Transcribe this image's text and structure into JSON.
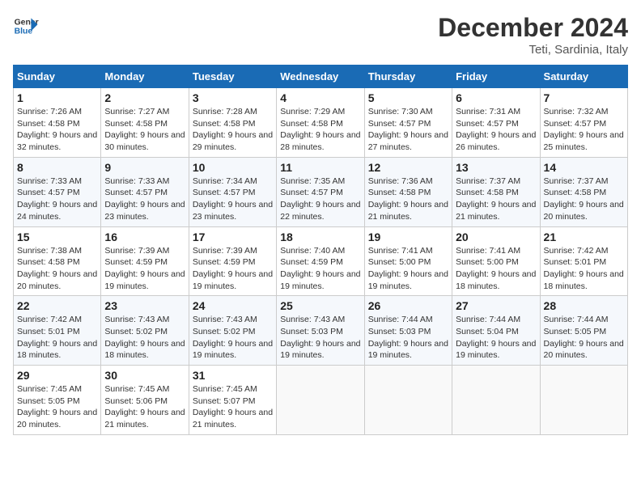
{
  "logo": {
    "line1": "General",
    "line2": "Blue"
  },
  "title": "December 2024",
  "subtitle": "Teti, Sardinia, Italy",
  "days_header": [
    "Sunday",
    "Monday",
    "Tuesday",
    "Wednesday",
    "Thursday",
    "Friday",
    "Saturday"
  ],
  "weeks": [
    [
      {
        "num": "1",
        "sunrise": "7:26 AM",
        "sunset": "4:58 PM",
        "daylight": "9 hours and 32 minutes."
      },
      {
        "num": "2",
        "sunrise": "7:27 AM",
        "sunset": "4:58 PM",
        "daylight": "9 hours and 30 minutes."
      },
      {
        "num": "3",
        "sunrise": "7:28 AM",
        "sunset": "4:58 PM",
        "daylight": "9 hours and 29 minutes."
      },
      {
        "num": "4",
        "sunrise": "7:29 AM",
        "sunset": "4:58 PM",
        "daylight": "9 hours and 28 minutes."
      },
      {
        "num": "5",
        "sunrise": "7:30 AM",
        "sunset": "4:57 PM",
        "daylight": "9 hours and 27 minutes."
      },
      {
        "num": "6",
        "sunrise": "7:31 AM",
        "sunset": "4:57 PM",
        "daylight": "9 hours and 26 minutes."
      },
      {
        "num": "7",
        "sunrise": "7:32 AM",
        "sunset": "4:57 PM",
        "daylight": "9 hours and 25 minutes."
      }
    ],
    [
      {
        "num": "8",
        "sunrise": "7:33 AM",
        "sunset": "4:57 PM",
        "daylight": "9 hours and 24 minutes."
      },
      {
        "num": "9",
        "sunrise": "7:33 AM",
        "sunset": "4:57 PM",
        "daylight": "9 hours and 23 minutes."
      },
      {
        "num": "10",
        "sunrise": "7:34 AM",
        "sunset": "4:57 PM",
        "daylight": "9 hours and 23 minutes."
      },
      {
        "num": "11",
        "sunrise": "7:35 AM",
        "sunset": "4:57 PM",
        "daylight": "9 hours and 22 minutes."
      },
      {
        "num": "12",
        "sunrise": "7:36 AM",
        "sunset": "4:58 PM",
        "daylight": "9 hours and 21 minutes."
      },
      {
        "num": "13",
        "sunrise": "7:37 AM",
        "sunset": "4:58 PM",
        "daylight": "9 hours and 21 minutes."
      },
      {
        "num": "14",
        "sunrise": "7:37 AM",
        "sunset": "4:58 PM",
        "daylight": "9 hours and 20 minutes."
      }
    ],
    [
      {
        "num": "15",
        "sunrise": "7:38 AM",
        "sunset": "4:58 PM",
        "daylight": "9 hours and 20 minutes."
      },
      {
        "num": "16",
        "sunrise": "7:39 AM",
        "sunset": "4:59 PM",
        "daylight": "9 hours and 19 minutes."
      },
      {
        "num": "17",
        "sunrise": "7:39 AM",
        "sunset": "4:59 PM",
        "daylight": "9 hours and 19 minutes."
      },
      {
        "num": "18",
        "sunrise": "7:40 AM",
        "sunset": "4:59 PM",
        "daylight": "9 hours and 19 minutes."
      },
      {
        "num": "19",
        "sunrise": "7:41 AM",
        "sunset": "5:00 PM",
        "daylight": "9 hours and 19 minutes."
      },
      {
        "num": "20",
        "sunrise": "7:41 AM",
        "sunset": "5:00 PM",
        "daylight": "9 hours and 18 minutes."
      },
      {
        "num": "21",
        "sunrise": "7:42 AM",
        "sunset": "5:01 PM",
        "daylight": "9 hours and 18 minutes."
      }
    ],
    [
      {
        "num": "22",
        "sunrise": "7:42 AM",
        "sunset": "5:01 PM",
        "daylight": "9 hours and 18 minutes."
      },
      {
        "num": "23",
        "sunrise": "7:43 AM",
        "sunset": "5:02 PM",
        "daylight": "9 hours and 18 minutes."
      },
      {
        "num": "24",
        "sunrise": "7:43 AM",
        "sunset": "5:02 PM",
        "daylight": "9 hours and 19 minutes."
      },
      {
        "num": "25",
        "sunrise": "7:43 AM",
        "sunset": "5:03 PM",
        "daylight": "9 hours and 19 minutes."
      },
      {
        "num": "26",
        "sunrise": "7:44 AM",
        "sunset": "5:03 PM",
        "daylight": "9 hours and 19 minutes."
      },
      {
        "num": "27",
        "sunrise": "7:44 AM",
        "sunset": "5:04 PM",
        "daylight": "9 hours and 19 minutes."
      },
      {
        "num": "28",
        "sunrise": "7:44 AM",
        "sunset": "5:05 PM",
        "daylight": "9 hours and 20 minutes."
      }
    ],
    [
      {
        "num": "29",
        "sunrise": "7:45 AM",
        "sunset": "5:05 PM",
        "daylight": "9 hours and 20 minutes."
      },
      {
        "num": "30",
        "sunrise": "7:45 AM",
        "sunset": "5:06 PM",
        "daylight": "9 hours and 21 minutes."
      },
      {
        "num": "31",
        "sunrise": "7:45 AM",
        "sunset": "5:07 PM",
        "daylight": "9 hours and 21 minutes."
      },
      null,
      null,
      null,
      null
    ]
  ],
  "labels": {
    "sunrise": "Sunrise:",
    "sunset": "Sunset:",
    "daylight": "Daylight:"
  }
}
